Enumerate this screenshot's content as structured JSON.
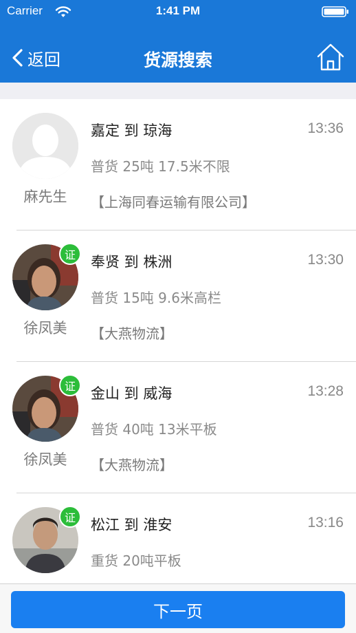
{
  "status_bar": {
    "carrier": "Carrier",
    "time": "1:41 PM"
  },
  "nav": {
    "back_label": "返回",
    "title": "货源搜索",
    "home_icon": "home-icon"
  },
  "colors": {
    "brand": "#1a78d8",
    "button": "#1a7ff0",
    "verified": "#2cbd3a"
  },
  "listings": [
    {
      "contact": "麻先生",
      "verified": false,
      "route": "嘉定 到 琼海",
      "time": "13:36",
      "cargo": "普货 25吨 17.5米不限",
      "company": "【上海同春运输有限公司】",
      "avatar": "default-person"
    },
    {
      "contact": "徐凤美",
      "verified": true,
      "badge": "证",
      "route": "奉贤 到 株洲",
      "time": "13:30",
      "cargo": "普货 15吨 9.6米高栏",
      "company": "【大燕物流】",
      "avatar": "woman-photo"
    },
    {
      "contact": "徐凤美",
      "verified": true,
      "badge": "证",
      "route": "金山 到 威海",
      "time": "13:28",
      "cargo": "普货 40吨 13米平板",
      "company": "【大燕物流】",
      "avatar": "woman-photo"
    },
    {
      "contact": "",
      "verified": true,
      "badge": "证",
      "route": "松江 到 淮安",
      "time": "13:16",
      "cargo": "重货 20吨平板",
      "company": "",
      "avatar": "man-photo"
    }
  ],
  "footer": {
    "next_page_label": "下一页"
  }
}
